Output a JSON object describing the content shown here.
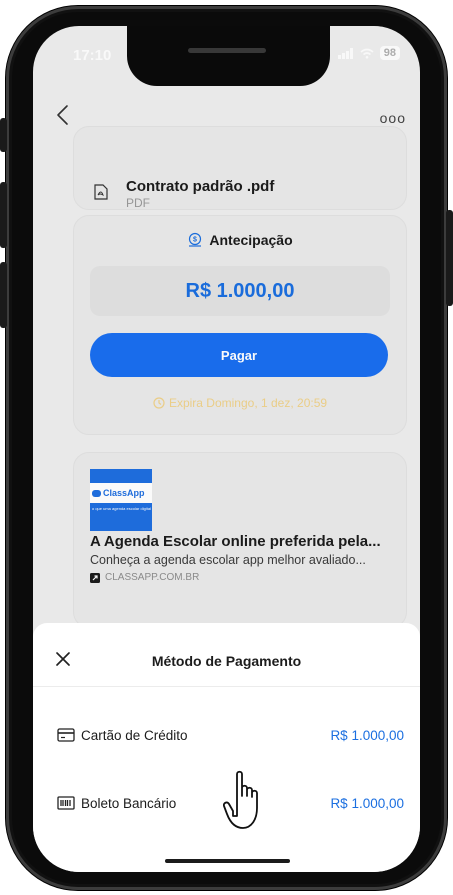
{
  "status_bar": {
    "time": "17:10",
    "battery": "98"
  },
  "nav": {
    "more_label": "ooo"
  },
  "file": {
    "name": "Contrato padrão .pdf",
    "type": "PDF"
  },
  "anticipation": {
    "title": "Antecipação",
    "amount": "R$ 1.000,00",
    "pay_label": "Pagar",
    "expires": "Expira Domingo, 1 dez, 20:59"
  },
  "link_preview": {
    "thumb_brand": "ClassApp",
    "thumb_tagline": "o que uma agenda escolar digital",
    "title": "A Agenda Escolar online preferida pela...",
    "description": "Conheça a agenda escolar app melhor avaliado...",
    "domain": "CLASSAPP.COM.BR"
  },
  "payment_sheet": {
    "title": "Método de Pagamento",
    "methods": [
      {
        "label": "Cartão de Crédito",
        "price": "R$ 1.000,00",
        "icon": "credit-card-icon"
      },
      {
        "label": "Boleto Bancário",
        "price": "R$ 1.000,00",
        "icon": "barcode-icon"
      }
    ]
  },
  "colors": {
    "accent": "#1a6ff0",
    "warning": "#efd28a",
    "sheet_bg": "#ffffff",
    "screen_bg": "#eeeeee"
  }
}
